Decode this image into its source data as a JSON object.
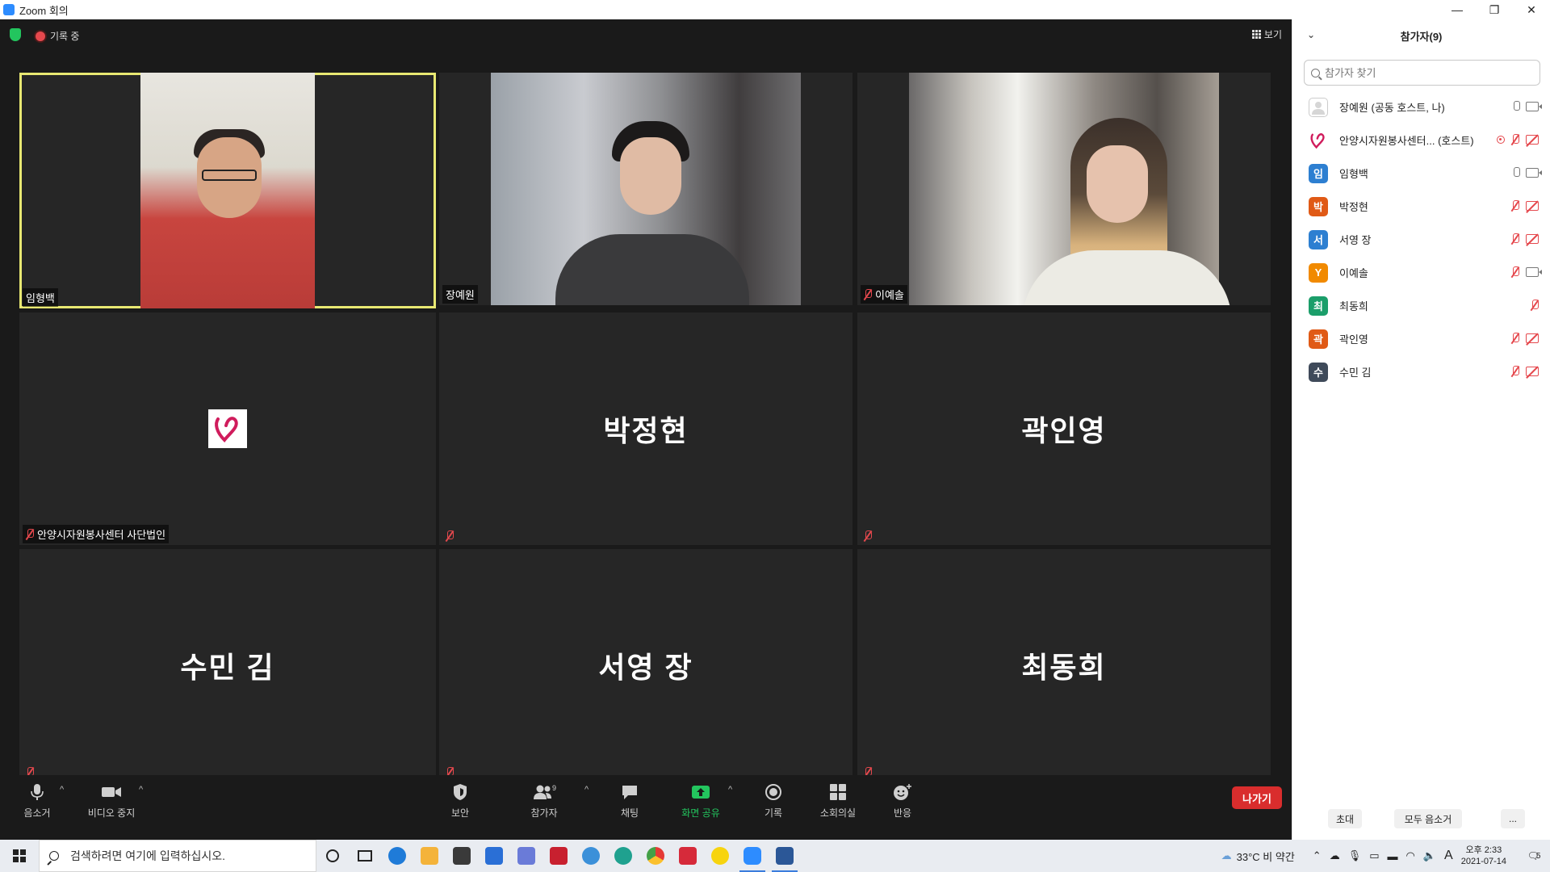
{
  "window": {
    "title": "Zoom 회의",
    "minimize": "—",
    "restore": "❐",
    "close": "✕"
  },
  "topbar": {
    "recording_label": "기록 중",
    "view_label": "보기"
  },
  "tiles": [
    {
      "name": "임형백",
      "video": true,
      "muted": false,
      "active": true
    },
    {
      "name": "장예원",
      "video": true,
      "muted": false,
      "active": false
    },
    {
      "name": "이예솔",
      "video": true,
      "muted": true,
      "active": false
    },
    {
      "name": "안양시자원봉사센터 사단법인",
      "video": false,
      "logo": true,
      "muted": true
    },
    {
      "name": "박정현",
      "video": false,
      "muted": true
    },
    {
      "name": "곽인영",
      "video": false,
      "muted": true
    },
    {
      "name": "수민 김",
      "video": false,
      "muted": true
    },
    {
      "name": "서영 장",
      "video": false,
      "muted": true
    },
    {
      "name": "최동희",
      "video": false,
      "muted": true
    }
  ],
  "toolbar": {
    "mute": "음소거",
    "stop_video": "비디오 중지",
    "security": "보안",
    "participants": "참가자",
    "participants_count": "9",
    "chat": "채팅",
    "share": "화면 공유",
    "record": "기록",
    "breakout": "소회의실",
    "reactions": "반응",
    "leave": "나가기",
    "caret": "^"
  },
  "panel": {
    "title": "참가자(9)",
    "collapse": "⌄",
    "search_placeholder": "참가자 찾기",
    "participants": [
      {
        "initial": "",
        "name": "장예원 (공동 호스트, 나)",
        "color": "#ffffff",
        "mic": "on",
        "cam": "on"
      },
      {
        "initial": "",
        "name": "안양시자원봉사센터... (호스트)",
        "color": "#ffffff",
        "mic": "off",
        "cam": "off",
        "recording": true
      },
      {
        "initial": "임",
        "name": "임형백",
        "color": "#2d7fd1",
        "mic": "on",
        "cam": "on"
      },
      {
        "initial": "박",
        "name": "박정현",
        "color": "#e05a16",
        "mic": "off",
        "cam": "off"
      },
      {
        "initial": "서",
        "name": "서영 장",
        "color": "#2d7fd1",
        "mic": "off",
        "cam": "off"
      },
      {
        "initial": "Y",
        "name": "이예솔",
        "color": "#f18a00",
        "mic": "off",
        "cam": "on"
      },
      {
        "initial": "최",
        "name": "최동희",
        "color": "#1b9e6a",
        "mic": "off",
        "cam": "none"
      },
      {
        "initial": "곽",
        "name": "곽인영",
        "color": "#e05a16",
        "mic": "off",
        "cam": "off"
      },
      {
        "initial": "수",
        "name": "수민 김",
        "color": "#3f4a5a",
        "mic": "off",
        "cam": "off"
      }
    ],
    "invite": "초대",
    "mute_all": "모두 음소거",
    "more": "..."
  },
  "taskbar": {
    "search_placeholder": "검색하려면 여기에 입력하십시오.",
    "weather": "33°C  비 약간",
    "ime": "A",
    "time": "오후 2:33",
    "date": "2021-07-14",
    "notification_count": "5",
    "app_colors": [
      "#1f7bd8",
      "#f4b33a",
      "#d98d1e",
      "#2a6fd6",
      "#6a7bd8",
      "#c8202f",
      "#3b90d9",
      "#1fa18f",
      "#e0a71e",
      "#d62a3a",
      "#f7d40f",
      "#2d8cff",
      "#2b5797"
    ]
  }
}
